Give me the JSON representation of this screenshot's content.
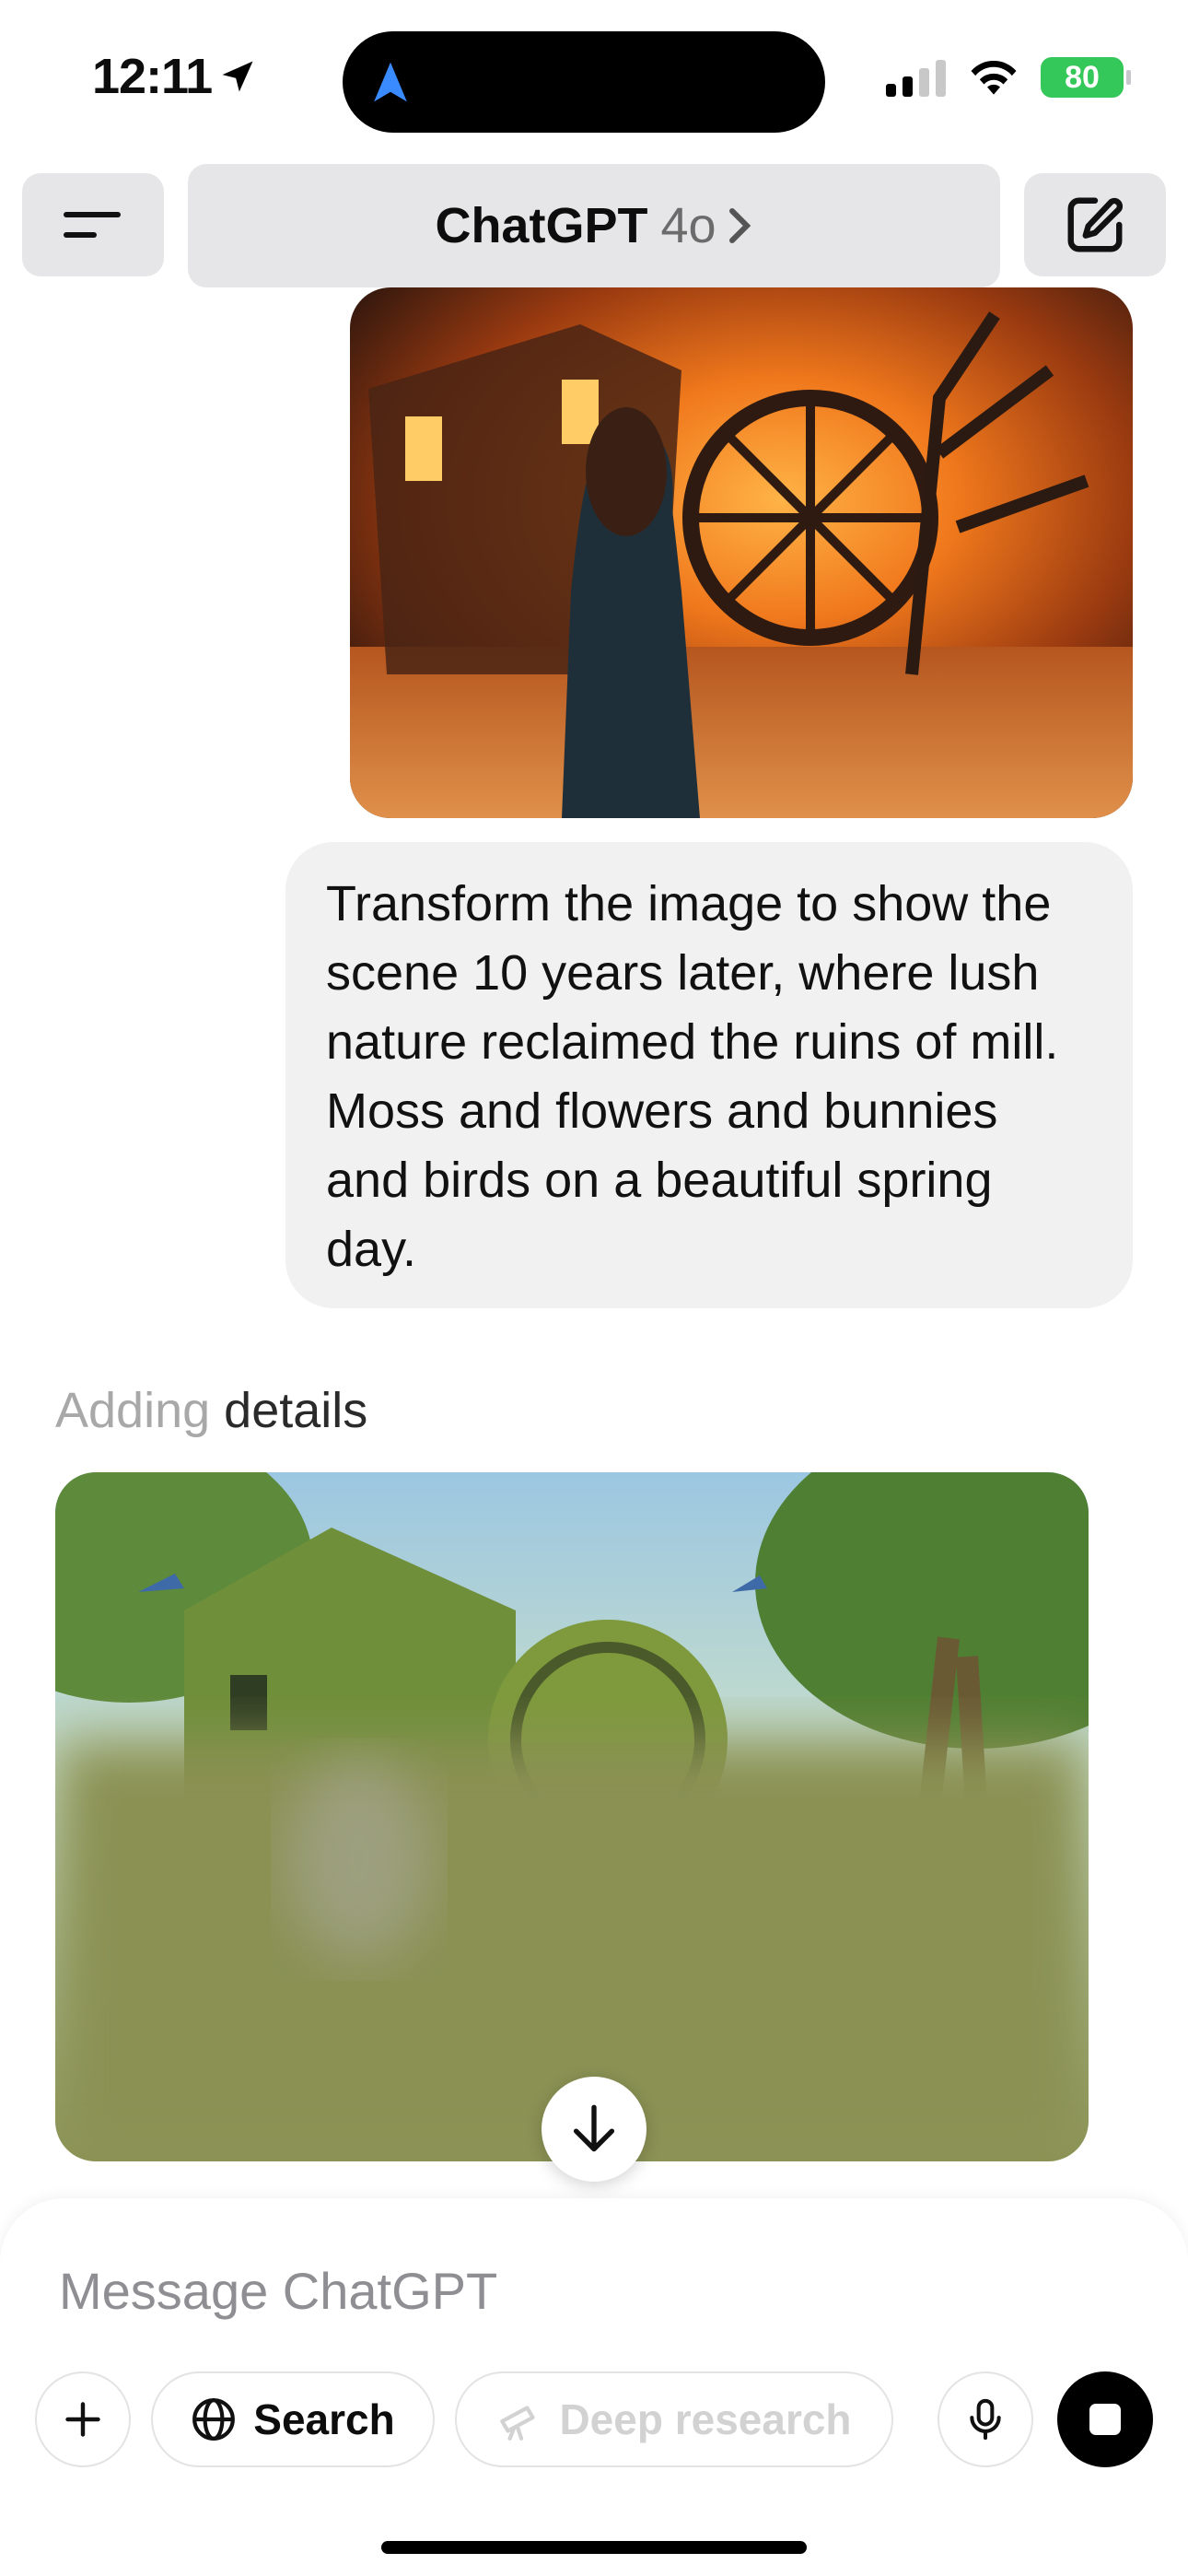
{
  "status_bar": {
    "time": "12:11",
    "battery": "80"
  },
  "header": {
    "title": "ChatGPT",
    "model": "4o",
    "chevron": ">"
  },
  "conversation": {
    "user_image_desc": "burning-mill-image",
    "user_message": "Transform the image to show the scene 10 years later, where lush nature reclaimed the ruins of mill. Moss and flowers and bunnies and birds on a beautiful spring day.",
    "assistant_status_faded": "Adding",
    "assistant_status_bold": " details"
  },
  "composer": {
    "placeholder": "Message ChatGPT",
    "search_label": "Search",
    "deep_research_label": "Deep research"
  },
  "icons": [
    "location-arrow-icon",
    "navigation-icon",
    "signal-icon",
    "wifi-icon",
    "battery-icon",
    "menu-icon",
    "new-chat-icon",
    "chevron-right-icon",
    "arrow-down-icon",
    "plus-icon",
    "globe-icon",
    "telescope-icon",
    "microphone-icon",
    "stop-icon"
  ]
}
